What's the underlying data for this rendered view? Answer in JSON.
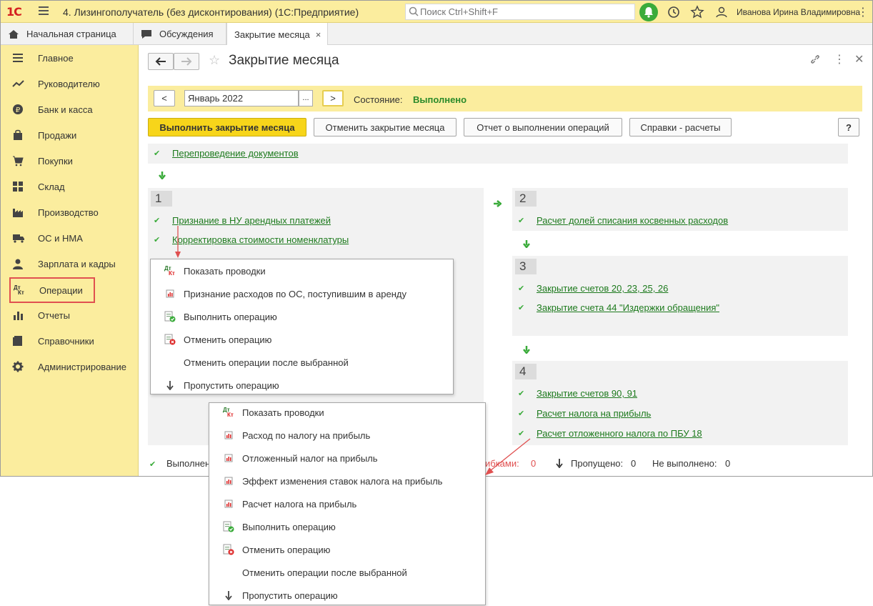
{
  "titlebar": {
    "logo": "1С",
    "app_title": "4. Лизингополучатель (без дисконтирования)  (1С:Предприятие)",
    "search_placeholder": "Поиск Ctrl+Shift+F",
    "user_name": "Иванова Ирина Владимировна"
  },
  "tabs": [
    {
      "label": "Начальная страница"
    },
    {
      "label": "Обсуждения"
    },
    {
      "label": "Закрытие месяца",
      "close": "×"
    }
  ],
  "sidebar": {
    "items": [
      {
        "label": "Главное"
      },
      {
        "label": "Руководителю"
      },
      {
        "label": "Банк и касса"
      },
      {
        "label": "Продажи"
      },
      {
        "label": "Покупки"
      },
      {
        "label": "Склад"
      },
      {
        "label": "Производство"
      },
      {
        "label": "ОС и НМА"
      },
      {
        "label": "Зарплата и кадры"
      },
      {
        "label": "Операции"
      },
      {
        "label": "Отчеты"
      },
      {
        "label": "Справочники"
      },
      {
        "label": "Администрирование"
      }
    ]
  },
  "content": {
    "title": "Закрытие месяца",
    "period": {
      "prev": "<",
      "next": ">",
      "value": "Январь 2022",
      "dots": "...",
      "state_label": "Состояние:",
      "state_value": "Выполнено"
    },
    "buttons": {
      "run": "Выполнить закрытие месяца",
      "cancel": "Отменить закрытие месяца",
      "report": "Отчет о выполнении операций",
      "calc": "Справки - расчеты",
      "help": "?"
    },
    "repost": "Перепроведение документов",
    "stages": [
      {
        "num": "1",
        "ops": [
          "Признание в НУ арендных платежей",
          "Корректировка стоимости номенклатуры"
        ]
      },
      {
        "num": "2",
        "ops": [
          "Расчет долей списания косвенных расходов"
        ]
      },
      {
        "num": "3",
        "ops": [
          "Закрытие счетов 20, 23, 25, 26",
          "Закрытие счета 44 \"Издержки обращения\""
        ]
      },
      {
        "num": "4",
        "ops": [
          "Закрытие счетов 90, 91",
          "Расчет налога на прибыль",
          "Расчет отложенного налога по ПБУ 18"
        ]
      }
    ],
    "status": {
      "done": "Выполнено",
      "errors_tail": "ибками:",
      "errors_count": "0",
      "skipped_label": "Пропущено:",
      "skipped_count": "0",
      "not_done_label": "Не выполнено:",
      "not_done_count": "0"
    }
  },
  "menu1": {
    "items": [
      "Показать проводки",
      "Признание расходов по ОС, поступившим в аренду",
      "Выполнить операцию",
      "Отменить операцию",
      "Отменить операции после выбранной",
      "Пропустить операцию"
    ]
  },
  "menu2": {
    "items": [
      "Показать проводки",
      "Расход по налогу на прибыль",
      "Отложенный налог на прибыль",
      "Эффект изменения ставок налога на прибыль",
      "Расчет налога на прибыль",
      "Выполнить операцию",
      "Отменить операцию",
      "Отменить операции после выбранной",
      "Пропустить операцию"
    ]
  },
  "colors": {
    "accent_yellow": "#fbed9e",
    "button_yellow": "#f7d51a",
    "link_green": "#1d7a1d",
    "check_green": "#3aab3a",
    "error_red": "#e05050"
  }
}
